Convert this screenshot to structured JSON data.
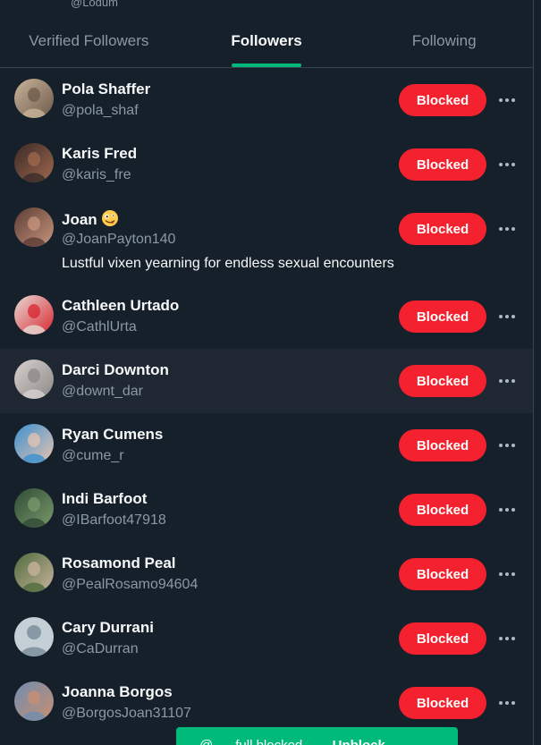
{
  "profile": {
    "handle": "@Lodum"
  },
  "tabs": [
    "Verified Followers",
    "Followers",
    "Following"
  ],
  "followers": [
    {
      "name": "Pola Shaffer",
      "handle": "@pola_shaf",
      "button": "Blocked",
      "avatar_colors": [
        "#c8b39a",
        "#6e5a4a"
      ]
    },
    {
      "name": "Karis Fred",
      "handle": "@karis_fre",
      "button": "Blocked",
      "avatar_colors": [
        "#3a2a28",
        "#a0684e"
      ]
    },
    {
      "name": "Joan",
      "handle": "@JoanPayton140",
      "bio": "Lustful vixen yearning for endless sexual encounters",
      "button": "Blocked",
      "avatar_colors": [
        "#5a3c34",
        "#c9967e"
      ]
    },
    {
      "name": "Cathleen Urtado",
      "handle": "@CathlUrta",
      "button": "Blocked",
      "avatar_colors": [
        "#e7dcd6",
        "#d8262f"
      ]
    },
    {
      "name": "Darci Downton",
      "handle": "@downt_dar",
      "button": "Blocked",
      "avatar_colors": [
        "#d7d2cf",
        "#8c8885"
      ]
    },
    {
      "name": "Ryan Cumens",
      "handle": "@cume_r",
      "button": "Blocked",
      "avatar_colors": [
        "#3a90d0",
        "#e8c4b0"
      ]
    },
    {
      "name": "Indi Barfoot",
      "handle": "@IBarfoot47918",
      "button": "Blocked",
      "avatar_colors": [
        "#2f4a35",
        "#7a9a6b"
      ]
    },
    {
      "name": "Rosamond Peal",
      "handle": "@PealRosamo94604",
      "button": "Blocked",
      "avatar_colors": [
        "#4e6b3c",
        "#c9b39c"
      ]
    },
    {
      "name": "Cary Durrani",
      "handle": "@CaDurran",
      "button": "Blocked",
      "avatar_colors": [
        "#c4cfd6",
        "#8899a6"
      ]
    },
    {
      "name": "Joanna Borgos",
      "handle": "@BorgosJoan31107",
      "button": "Blocked",
      "avatar_colors": [
        "#6f8fb0",
        "#c98d70"
      ]
    }
  ],
  "toast": {
    "prefix": "@......full blocked ......",
    "bold": "Unblock ..."
  },
  "colors": {
    "background": "#15202b",
    "blocked": "#f4212e",
    "accent": "#00ba7c",
    "muted": "#8b98a5"
  }
}
